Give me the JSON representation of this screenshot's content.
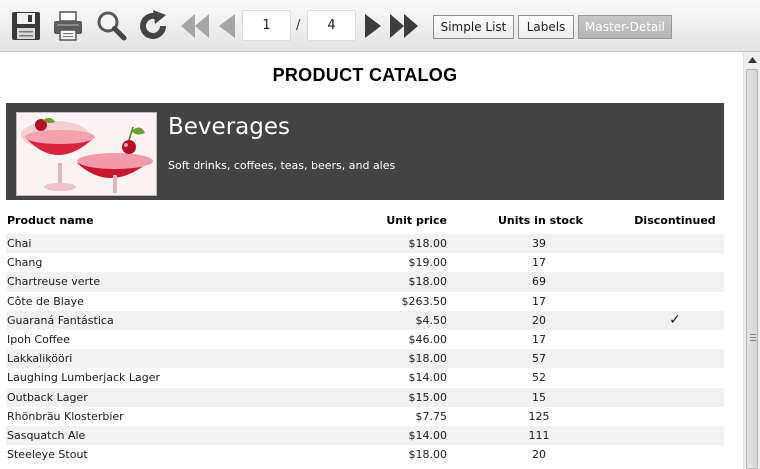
{
  "toolbar": {
    "icons": [
      "save-icon",
      "print-icon",
      "search-icon",
      "refresh-icon",
      "first-page-icon",
      "previous-page-icon",
      "next-page-icon",
      "last-page-icon"
    ],
    "current_page": "1",
    "page_separator": "/",
    "total_pages": "4",
    "views": [
      "Simple List",
      "Labels",
      "Master-Detail"
    ],
    "active_view": "Master-Detail"
  },
  "report": {
    "title": "PRODUCT CATALOG",
    "category": {
      "name": "Beverages",
      "description": "Soft drinks, coffees, teas, beers, and ales"
    },
    "columns": [
      "Product name",
      "Unit price",
      "Units in stock",
      "Discontinued"
    ],
    "rows": [
      {
        "name": "Chai",
        "price": "$18.00",
        "stock": "39",
        "discontinued": ""
      },
      {
        "name": "Chang",
        "price": "$19.00",
        "stock": "17",
        "discontinued": ""
      },
      {
        "name": "Chartreuse verte",
        "price": "$18.00",
        "stock": "69",
        "discontinued": ""
      },
      {
        "name": "Côte de Blaye",
        "price": "$263.50",
        "stock": "17",
        "discontinued": ""
      },
      {
        "name": "Guaraná Fantástica",
        "price": "$4.50",
        "stock": "20",
        "discontinued": "✓"
      },
      {
        "name": "Ipoh Coffee",
        "price": "$46.00",
        "stock": "17",
        "discontinued": ""
      },
      {
        "name": "Lakkalikööri",
        "price": "$18.00",
        "stock": "57",
        "discontinued": ""
      },
      {
        "name": "Laughing Lumberjack Lager",
        "price": "$14.00",
        "stock": "52",
        "discontinued": ""
      },
      {
        "name": "Outback Lager",
        "price": "$15.00",
        "stock": "15",
        "discontinued": ""
      },
      {
        "name": "Rhönbräu Klosterbier",
        "price": "$7.75",
        "stock": "125",
        "discontinued": ""
      },
      {
        "name": "Sasquatch Ale",
        "price": "$14.00",
        "stock": "111",
        "discontinued": ""
      },
      {
        "name": "Steeleye Stout",
        "price": "$18.00",
        "stock": "20",
        "discontinued": ""
      }
    ]
  },
  "colors": {
    "header_band": "#434343",
    "row_alt": "#f1f1f1",
    "toolbar_bg": "#e8e8e8"
  }
}
